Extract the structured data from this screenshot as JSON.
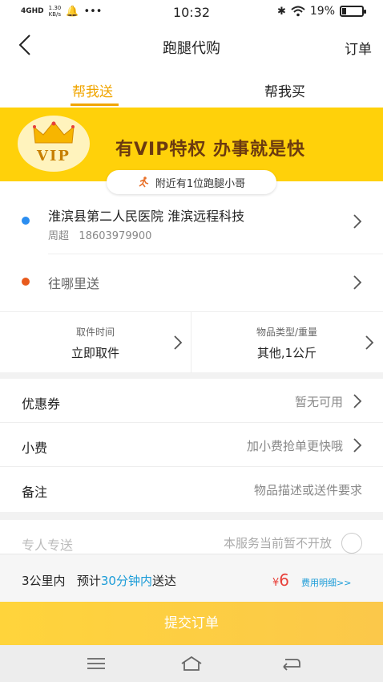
{
  "status_bar": {
    "network": "4GHD",
    "speed_value": "1.30",
    "speed_unit": "KB/s",
    "time": "10:32",
    "battery_text": "19%",
    "battery_level": 0.19
  },
  "nav": {
    "title": "跑腿代购",
    "orders_label": "订单"
  },
  "tabs": [
    {
      "label": "帮我送",
      "active": true
    },
    {
      "label": "帮我买",
      "active": false
    }
  ],
  "vip_banner": {
    "badge_text": "VIP",
    "slogan": "有VIP特权  办事就是快",
    "nearby_text": "附近有1位跑腿小哥"
  },
  "pickup": {
    "address": "淮滨县第二人民医院 淮滨远程科技",
    "contact_name": "周超",
    "contact_phone": "18603979900"
  },
  "delivery": {
    "placeholder": "往哪里送"
  },
  "pickup_time": {
    "label": "取件时间",
    "value": "立即取件"
  },
  "item_info": {
    "label": "物品类型/重量",
    "value": "其他,1公斤"
  },
  "options": {
    "coupon_label": "优惠券",
    "coupon_value": "暂无可用",
    "tip_label": "小费",
    "tip_value": "加小费抢单更快哦",
    "note_label": "备注",
    "note_placeholder": "物品描述或送件要求"
  },
  "special_delivery": {
    "label": "专人专送",
    "value": "本服务当前暂不开放"
  },
  "summary": {
    "distance": "3公里内",
    "estimate_prefix": "预计",
    "estimate_time": "30分钟内",
    "estimate_suffix": "送达",
    "currency": "¥",
    "price": "6",
    "fee_detail": "费用明细>>"
  },
  "submit_label": "提交订单",
  "colors": {
    "accent": "#f0a500",
    "banner": "#ffd10a",
    "link": "#1a9bd7",
    "price": "#e8403a"
  }
}
